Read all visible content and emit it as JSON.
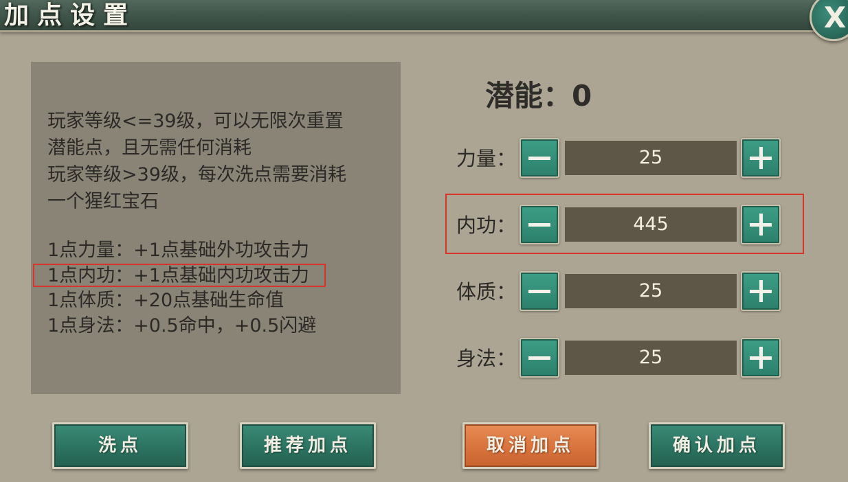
{
  "window": {
    "title": "加点设置"
  },
  "close_label": "X",
  "info": {
    "description_lines": [
      "玩家等级<=39级，可以无限次重置",
      "潜能点，且无需任何消耗",
      "玩家等级>39级，每次洗点需要消耗",
      "一个猩红宝石"
    ],
    "rules": [
      "1点力量：+1点基础外功攻击力",
      "1点内功：+1点基础内功攻击力",
      "1点体质：+20点基础生命值",
      "1点身法：+0.5命中，+0.5闪避"
    ]
  },
  "potential": {
    "label": "潜能：0"
  },
  "stats": [
    {
      "label": "力量：",
      "value": "25"
    },
    {
      "label": "内功：",
      "value": "445"
    },
    {
      "label": "体质：",
      "value": "25"
    },
    {
      "label": "身法：",
      "value": "25"
    }
  ],
  "actions": {
    "reset": "洗点",
    "recommend": "推荐加点",
    "cancel": "取消加点",
    "confirm": "确认加点"
  },
  "colors": {
    "accent_green": "#2c7f6b",
    "cancel_orange": "#d8733d",
    "highlight_red": "#d9332a",
    "panel_bg": "#8a8477"
  }
}
